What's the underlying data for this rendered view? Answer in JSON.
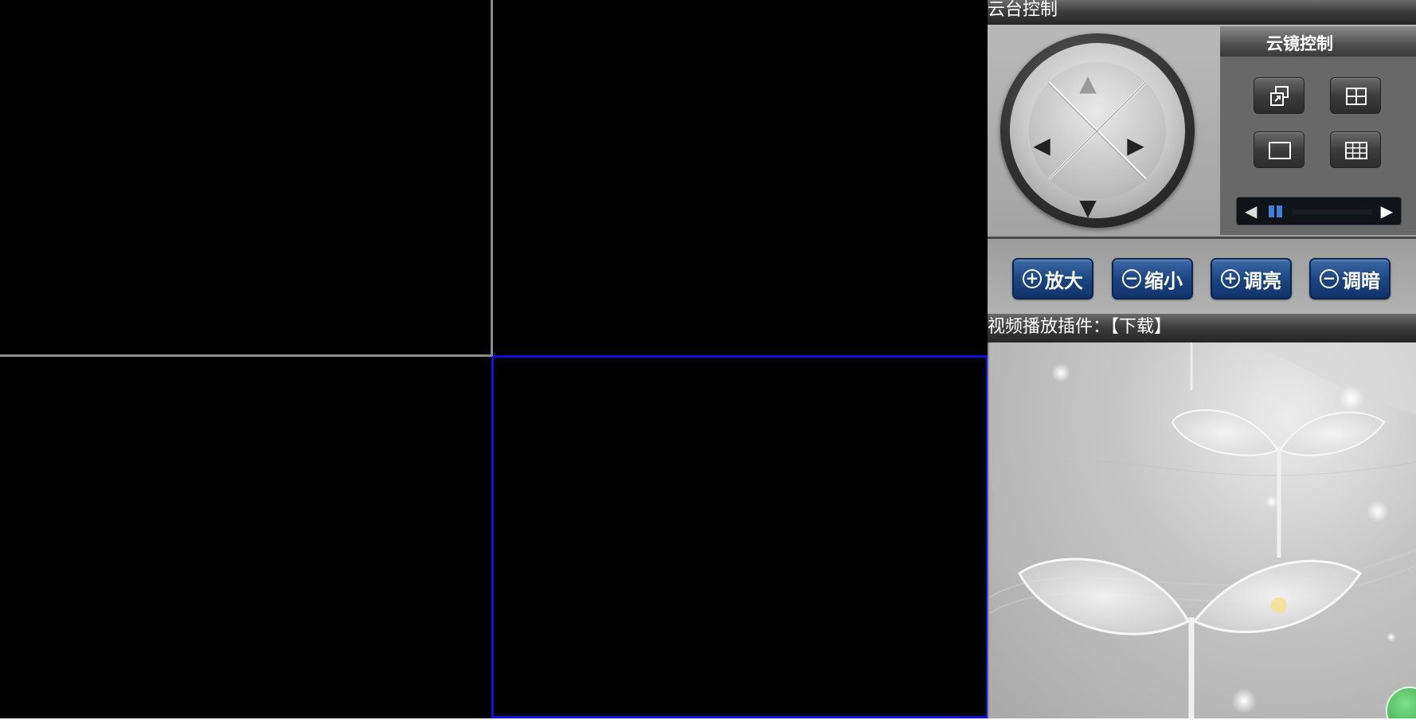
{
  "video_grid": {
    "active_cell": 4,
    "selected_border_color": "#1010e0",
    "divider_color": "#8c8c8c"
  },
  "ptz": {
    "title": "云台控制",
    "joystick": {
      "up": "▲",
      "down": "▼",
      "left": "◀",
      "right": "▶"
    }
  },
  "lens": {
    "title": "云镜控制",
    "layout_buttons": [
      {
        "icon": "popout-window-icon"
      },
      {
        "icon": "grid-2x2-icon"
      },
      {
        "icon": "single-view-icon"
      },
      {
        "icon": "grid-3x3-icon"
      }
    ],
    "pager": {
      "prev": "◀",
      "next": "▶",
      "accent": "#3f7fd8"
    }
  },
  "zoom_controls": {
    "zoom_in": {
      "symbol": "+",
      "label": "放大"
    },
    "zoom_out": {
      "symbol": "−",
      "label": "缩小"
    },
    "brighten": {
      "symbol": "+",
      "label": "调亮"
    },
    "darken": {
      "symbol": "−",
      "label": "调暗"
    },
    "accent": "#1c4682"
  },
  "plugin": {
    "label": "视频播放插件：",
    "link": "【下载】"
  }
}
